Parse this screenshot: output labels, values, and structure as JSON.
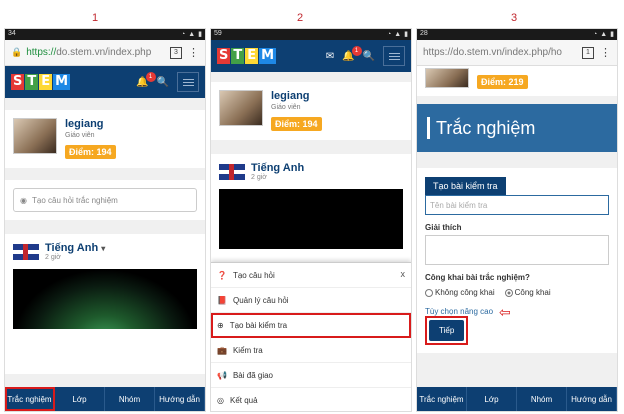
{
  "steps": [
    "1",
    "2",
    "3"
  ],
  "status_time": [
    "34",
    "59",
    "28"
  ],
  "browser": {
    "url1_scheme": "https://",
    "url1_rest": "do.stem.vn/index.php",
    "url3": "https://do.stem.vn/index.php/ho",
    "tab_count": "3",
    "tab_count3": "1"
  },
  "app": {
    "logo_letters": [
      "S",
      "T",
      "E",
      "M"
    ],
    "logo_colors": [
      "#e53935",
      "#43a047",
      "#fdd835",
      "#1e88e5"
    ],
    "notif_count": "1"
  },
  "profile": {
    "name": "legiang",
    "role": "Giáo viên",
    "points_label": "Điểm:",
    "points": "194",
    "points3": "219"
  },
  "composer": {
    "placeholder": "Tạo câu hỏi trắc nghiệm"
  },
  "post": {
    "title": "Tiếng Anh",
    "time": "2 giờ"
  },
  "bottom_nav": [
    "Trắc nghiệm",
    "Lớp",
    "Nhóm",
    "Hướng dẫn"
  ],
  "popup_menu": {
    "close": "x",
    "items": [
      "Tạo câu hỏi",
      "Quản lý câu hỏi",
      "Tạo bài kiểm tra",
      "Kiểm tra",
      "Bài đã giao",
      "Kết quả"
    ]
  },
  "quiz": {
    "header": "Trắc nghiệm",
    "tab": "Tạo bài kiểm tra",
    "name_placeholder": "Tên bài kiểm tra",
    "explain_label": "Giải thích",
    "public_label": "Công khai bài trắc nghiệm?",
    "opt_private": "Không công khai",
    "opt_public": "Công khai",
    "advanced": "Tùy chọn nâng cao",
    "next": "Tiếp"
  }
}
